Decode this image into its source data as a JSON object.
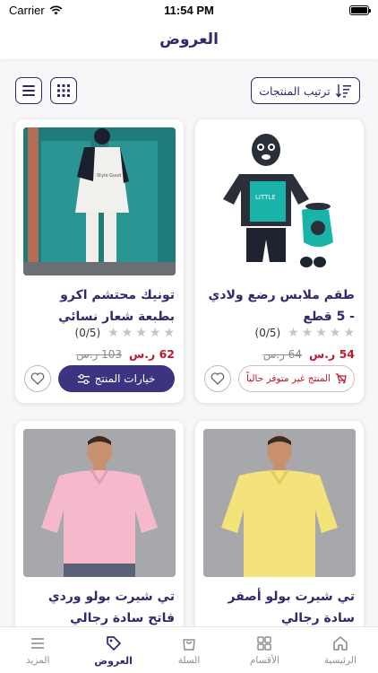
{
  "status_bar": {
    "carrier": "Carrier",
    "time": "11:54 PM"
  },
  "header": {
    "title": "العروض"
  },
  "toolbar": {
    "sort_label": "ترتيب المنتجات",
    "icons": [
      "sort-icon",
      "grid-view-icon",
      "list-view-icon"
    ]
  },
  "products": [
    {
      "name": "طقم ملابس رضع ولادي - 5 قطع",
      "rating": "(0/5)",
      "price": "54 ر.س",
      "old_price": "64 ر.س",
      "action_label": "المنتج غير متوفر حالياً",
      "available": false
    },
    {
      "name": "تونيك محتشم اكرو بطبعة شعار نسائي",
      "rating": "(0/5)",
      "price": "62 ر.س",
      "old_price": "103 ر.س",
      "action_label": "خيارات المنتج",
      "available": true
    },
    {
      "name": "تي شيرت بولو أصفر سادة رجالي"
    },
    {
      "name": "تي شيرت بولو وردي فاتح سادة رجالي"
    }
  ],
  "bottom_nav": {
    "items": [
      {
        "label": "الرئيسية",
        "icon": "home-icon"
      },
      {
        "label": "الأقسام",
        "icon": "categories-icon"
      },
      {
        "label": "السلة",
        "icon": "cart-icon"
      },
      {
        "label": "العروض",
        "icon": "offers-tag-icon"
      },
      {
        "label": "المزيد",
        "icon": "menu-icon"
      }
    ],
    "active": "العروض"
  },
  "colors": {
    "primary": "#3c3480",
    "price_red": "#c0172b",
    "star_gray": "#c4c4c4"
  }
}
